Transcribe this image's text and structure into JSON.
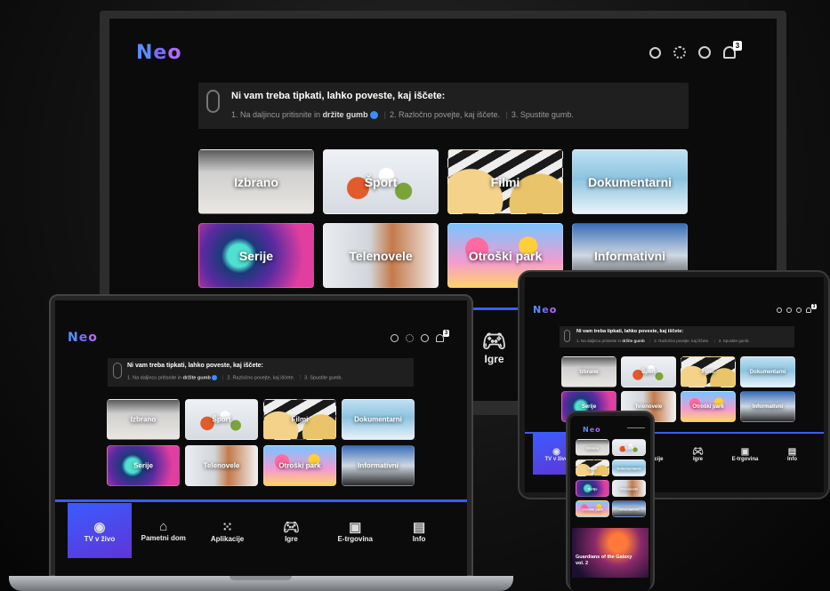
{
  "brand": {
    "logo_n": "N",
    "logo_e": "e",
    "logo_o": "o"
  },
  "header": {
    "notification_count": "3",
    "icons": [
      "search-icon",
      "gear-icon",
      "user-icon",
      "bell-icon"
    ]
  },
  "voice_banner": {
    "title": "Ni vam treba tipkati, lahko poveste, kaj iščete:",
    "step1_prefix": "1. Na daljincu pritisnite in ",
    "step1_bold": "držite gumb",
    "step2": "2. Razločno povejte, kaj iščete.",
    "step3": "3. Spustite gumb."
  },
  "categories": [
    {
      "label": "Izbrano"
    },
    {
      "label": "Šport"
    },
    {
      "label": "Filmi"
    },
    {
      "label": "Dokumentarni"
    },
    {
      "label": "Serije"
    },
    {
      "label": "Telenovele"
    },
    {
      "label": "Otroški park"
    },
    {
      "label": "Informativni"
    }
  ],
  "nav": [
    {
      "label": "TV v živo",
      "icon": "live-tv-icon"
    },
    {
      "label": "Pametni dom",
      "icon": "home-icon"
    },
    {
      "label": "Aplikacije",
      "icon": "apps-icon"
    },
    {
      "label": "Igre",
      "icon": "gamepad-icon"
    },
    {
      "label": "E-trgovina",
      "icon": "shop-icon"
    },
    {
      "label": "Info",
      "icon": "info-icon"
    }
  ],
  "phone": {
    "featured_title": "Guardians of the Galaxy vol. 2"
  },
  "colors": {
    "accent": "#3b5cff",
    "accent2": "#5e35d6",
    "banner_bg": "#1f1f1f",
    "screen_bg": "#0b0b0b"
  }
}
